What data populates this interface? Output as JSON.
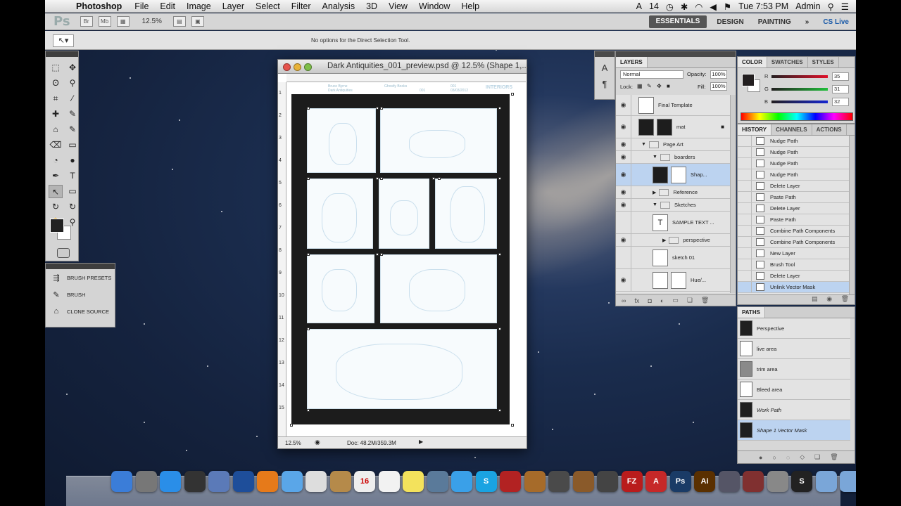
{
  "menubar": {
    "app_name": "Photoshop",
    "menus": [
      "File",
      "Edit",
      "Image",
      "Layer",
      "Select",
      "Filter",
      "Analysis",
      "3D",
      "View",
      "Window",
      "Help"
    ],
    "status": {
      "adobe_badge": "14",
      "clock": "Tue 7:53 PM",
      "user": "Admin"
    }
  },
  "appbar": {
    "logo": "Ps",
    "br_button": "Br",
    "mb_button": "Mb",
    "zoom": "12.5%",
    "workspaces": [
      "ESSENTIALS",
      "DESIGN",
      "PAINTING"
    ],
    "active_workspace": "ESSENTIALS",
    "more": "»",
    "cs_live": "CS Live"
  },
  "tool_options": {
    "message": "No options for the Direct Selection Tool."
  },
  "tools": {
    "icons": [
      "marquee-icon",
      "move-icon",
      "lasso-icon",
      "quick-select-icon",
      "crop-icon",
      "eyedropper-icon",
      "healing-icon",
      "brush-icon",
      "stamp-icon",
      "history-brush-icon",
      "eraser-icon",
      "gradient-icon",
      "blur-icon",
      "dodge-icon",
      "pen-icon",
      "type-icon",
      "direct-selection-icon",
      "shape-icon",
      "3d-rotate-icon",
      "3d-orbit-icon",
      "hand-icon",
      "zoom-icon"
    ],
    "glyphs": [
      "⬚",
      "✥",
      "ʘ",
      "⚲",
      "⌗",
      "⁄",
      "✚",
      "✎",
      "⌂",
      "✎",
      "⌫",
      "▭",
      "◔",
      "●",
      "✒",
      "T",
      "↖",
      "▭",
      "↻",
      "↻",
      "✋",
      "⚲"
    ],
    "selected_index": 16
  },
  "brush_panel": {
    "items": [
      "BRUSH PRESETS",
      "BRUSH",
      "CLONE SOURCE"
    ]
  },
  "document": {
    "title": "Dark Antiquities_001_preview.psd @ 12.5% (Shape 1,...",
    "zoom": "12.5%",
    "doc_size": "Doc: 48.2M/359.3M",
    "header_word": "INTERIORS",
    "header_fields": [
      "Bruce Byrne",
      "Ghostly Books",
      "Dark Antiquities",
      "001",
      "001",
      "03/03/2012"
    ],
    "ruler_numbers": [
      "1",
      "2",
      "3",
      "4",
      "5",
      "6",
      "7",
      "8",
      "9",
      "10",
      "11",
      "12",
      "13",
      "14",
      "15"
    ]
  },
  "layers": {
    "tab": "LAYERS",
    "blend_mode": "Normal",
    "opacity_label": "Opacity:",
    "opacity": "100%",
    "lock_label": "Lock:",
    "fill_label": "Fill:",
    "fill": "100%",
    "rows": [
      {
        "name": "Final Template",
        "kind": "layer",
        "eye": true
      },
      {
        "name": "mat",
        "kind": "layer-mask",
        "eye": true
      },
      {
        "name": "Page Art",
        "kind": "group",
        "eye": true
      },
      {
        "name": "boarders",
        "kind": "group",
        "eye": true
      },
      {
        "name": "Shap...",
        "kind": "shape",
        "eye": true,
        "selected": true
      },
      {
        "name": "Reference",
        "kind": "group",
        "eye": true
      },
      {
        "name": "Sketches",
        "kind": "group",
        "eye": true
      },
      {
        "name": "SAMPLE TEXT ...",
        "kind": "text",
        "eye": false
      },
      {
        "name": "perspective",
        "kind": "group",
        "eye": true
      },
      {
        "name": "sketch 01",
        "kind": "layer",
        "eye": false
      },
      {
        "name": "Hue/...",
        "kind": "adjustment",
        "eye": true
      }
    ]
  },
  "color_panel": {
    "tabs": [
      "COLOR",
      "SWATCHES",
      "STYLES"
    ],
    "channels": [
      {
        "label": "R",
        "value": "35",
        "color": "#e0102a"
      },
      {
        "label": "G",
        "value": "31",
        "color": "#1fbf3a"
      },
      {
        "label": "B",
        "value": "32",
        "color": "#1626d0"
      }
    ]
  },
  "history": {
    "tabs": [
      "HISTORY",
      "CHANNELS",
      "ACTIONS"
    ],
    "items": [
      "Nudge Path",
      "Nudge Path",
      "Nudge Path",
      "Nudge Path",
      "Delete Layer",
      "Paste Path",
      "Delete Layer",
      "Paste Path",
      "Combine Path Components",
      "Combine Path Components",
      "New Layer",
      "Brush Tool",
      "Delete Layer",
      "Unlink Vector Mask"
    ],
    "selected_index": 13
  },
  "paths": {
    "tab": "PATHS",
    "items": [
      {
        "name": "Perspective",
        "thumb": "dark"
      },
      {
        "name": "live area",
        "thumb": "white"
      },
      {
        "name": "trim area",
        "thumb": "gray"
      },
      {
        "name": "Bleed area",
        "thumb": "white"
      },
      {
        "name": "Work Path",
        "thumb": "grid",
        "italic": true
      },
      {
        "name": "Shape 1 Vector Mask",
        "thumb": "grid",
        "italic": true,
        "selected": true
      }
    ]
  },
  "dock": {
    "icons": [
      {
        "name": "finder-icon",
        "color": "#3b7dd8",
        "label": ""
      },
      {
        "name": "launchpad-icon",
        "color": "#777",
        "label": ""
      },
      {
        "name": "app-store-icon",
        "color": "#2a8ee8",
        "label": ""
      },
      {
        "name": "dashboard-icon",
        "color": "#333",
        "label": ""
      },
      {
        "name": "preview-icon",
        "color": "#5b7ab8",
        "label": ""
      },
      {
        "name": "quicktime-icon",
        "color": "#1e4e9a",
        "label": ""
      },
      {
        "name": "firefox-icon",
        "color": "#e67a1a",
        "label": ""
      },
      {
        "name": "messages-icon",
        "color": "#5aa6e8",
        "label": ""
      },
      {
        "name": "textedit-icon",
        "color": "#ddd",
        "label": ""
      },
      {
        "name": "address-book-icon",
        "color": "#b58a4a",
        "label": ""
      },
      {
        "name": "calendar-icon",
        "color": "#eee",
        "label": "16"
      },
      {
        "name": "reminders-icon",
        "color": "#f2f2f2",
        "label": ""
      },
      {
        "name": "stickies-icon",
        "color": "#f3e25c",
        "label": ""
      },
      {
        "name": "iphoto-icon",
        "color": "#5a7a9a",
        "label": ""
      },
      {
        "name": "itunes-icon",
        "color": "#3aa0e8",
        "label": ""
      },
      {
        "name": "skype-icon",
        "color": "#1aa3e2",
        "label": "S"
      },
      {
        "name": "photo-booth-icon",
        "color": "#b22222",
        "label": ""
      },
      {
        "name": "image-capture-icon",
        "color": "#a66b2a",
        "label": ""
      },
      {
        "name": "imovie-icon",
        "color": "#4a4a4a",
        "label": ""
      },
      {
        "name": "garageband-icon",
        "color": "#8a5a2a",
        "label": ""
      },
      {
        "name": "steam-icon",
        "color": "#444",
        "label": ""
      },
      {
        "name": "filezilla-icon",
        "color": "#b91c1c",
        "label": "FZ"
      },
      {
        "name": "acrobat-icon",
        "color": "#c62828",
        "label": "A"
      },
      {
        "name": "photoshop-icon",
        "color": "#1a3b66",
        "label": "Ps"
      },
      {
        "name": "illustrator-icon",
        "color": "#5a3000",
        "label": "Ai"
      },
      {
        "name": "disk-utility-icon",
        "color": "#556",
        "label": ""
      },
      {
        "name": "photo-slideshow-icon",
        "color": "#803030",
        "label": ""
      },
      {
        "name": "system-preferences-icon",
        "color": "#888",
        "label": ""
      },
      {
        "name": "sketchbook-icon",
        "color": "#222",
        "label": "S"
      },
      {
        "name": "applications-folder-icon",
        "color": "#7aa6d8",
        "label": ""
      },
      {
        "name": "documents-folder-icon",
        "color": "#7aa6d8",
        "label": ""
      },
      {
        "name": "trash-icon",
        "color": "#aaa",
        "label": ""
      }
    ]
  }
}
